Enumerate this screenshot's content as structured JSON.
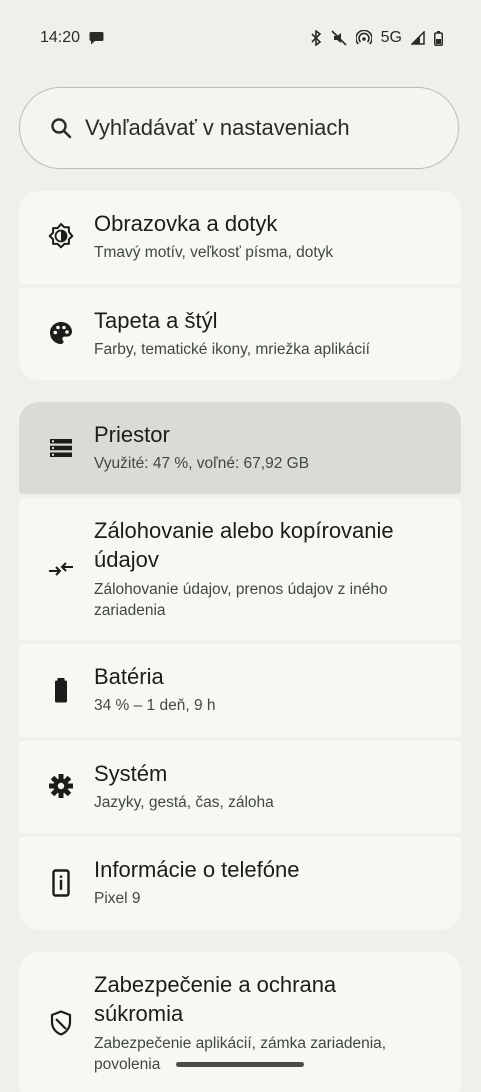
{
  "status_bar": {
    "time": "14:20",
    "network": "5G",
    "icons": [
      "message-icon",
      "bluetooth-icon",
      "mute-icon",
      "hotspot-icon",
      "signal-icon",
      "battery-icon"
    ]
  },
  "search": {
    "placeholder": "Vyhľadávať v nastaveniach",
    "icon": "search-icon"
  },
  "settings": [
    {
      "id": "display",
      "icon": "display-brightness-icon",
      "title": "Obrazovka a dotyk",
      "subtitle": "Tmavý motív, veľkosť písma, dotyk"
    },
    {
      "id": "wallpaper",
      "icon": "palette-icon",
      "title": "Tapeta a štýl",
      "subtitle": "Farby, tematické ikony, mriežka aplikácií"
    },
    {
      "id": "storage",
      "icon": "storage-icon",
      "title": "Priestor",
      "subtitle": "Využité: 47 %, voľné: 67,92 GB"
    },
    {
      "id": "backup",
      "icon": "transfer-icon",
      "title": "Zálohovanie alebo kopírovanie údajov",
      "subtitle": "Zálohovanie údajov, prenos údajov z iného zariadenia"
    },
    {
      "id": "battery",
      "icon": "battery-icon",
      "title": "Batéria",
      "subtitle": "34 % – 1 deň, 9 h"
    },
    {
      "id": "system",
      "icon": "gear-icon",
      "title": "Systém",
      "subtitle": "Jazyky, gestá, čas, záloha"
    },
    {
      "id": "about",
      "icon": "phone-info-icon",
      "title": "Informácie o telefóne",
      "subtitle": "Pixel 9"
    },
    {
      "id": "security",
      "icon": "shield-icon",
      "title": "Zabezpečenie a ochrana súkromia",
      "subtitle": "Zabezpečenie aplikácií, zámka zariadenia, povolenia"
    }
  ],
  "colors": {
    "background": "#eef0ec",
    "card": "#f6f9f2",
    "pressed_card": "#d9dcd5",
    "text_primary": "#1b1d1a",
    "text_secondary": "#43483f"
  }
}
